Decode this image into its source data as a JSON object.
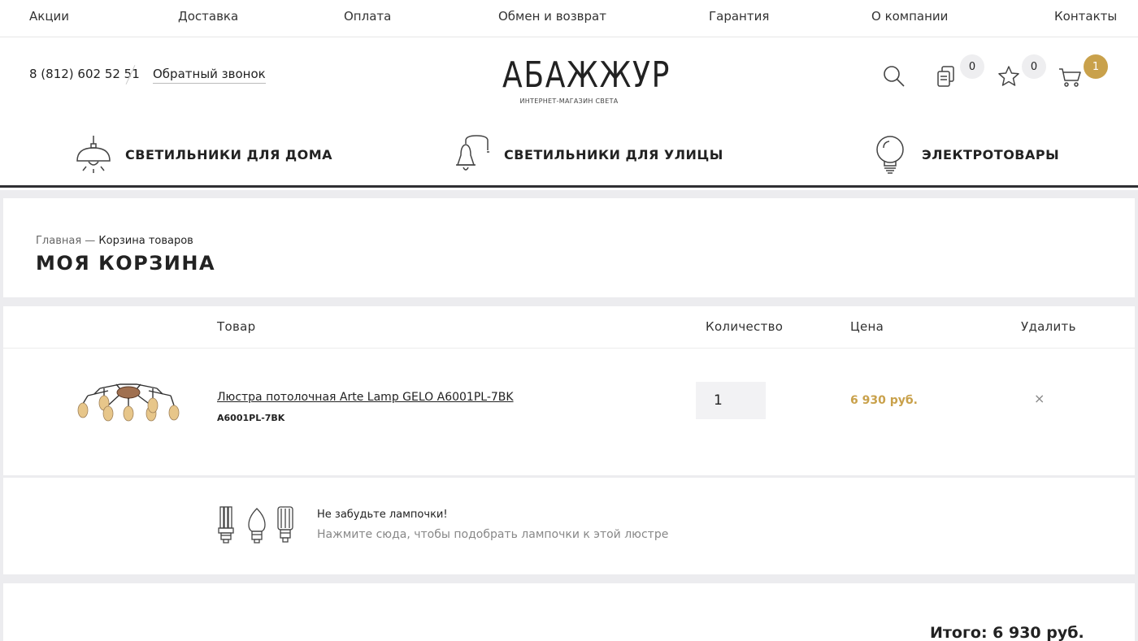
{
  "topnav": {
    "items": [
      "Акции",
      "Доставка",
      "Оплата",
      "Обмен и возврат",
      "Гарантия",
      "О компании",
      "Контакты"
    ]
  },
  "header": {
    "phone": "8 (812) 602 52 51",
    "callback": "Обратный звонок",
    "logo_main": "АБАЖЖУР",
    "logo_sub": "ИНТЕРНЕТ-МАГАЗИН СВЕТА",
    "compare_count": "0",
    "favorites_count": "0",
    "cart_count": "1",
    "icons": [
      "search-icon",
      "compare-icon",
      "star-icon",
      "cart-icon"
    ]
  },
  "categories": [
    {
      "label": "СВЕТИЛЬНИКИ ДЛЯ ДОМА",
      "icon": "pendant-lamp-icon"
    },
    {
      "label": "СВЕТИЛЬНИКИ ДЛЯ УЛИЦЫ",
      "icon": "street-lamp-icon"
    },
    {
      "label": "ЭЛЕКТРОТОВАРЫ",
      "icon": "bulb-icon"
    }
  ],
  "breadcrumb": {
    "home": "Главная",
    "separator": " — ",
    "current": "Корзина товаров"
  },
  "page_title": "МОЯ КОРЗИНА",
  "cart": {
    "columns": {
      "product": "Товар",
      "quantity": "Количество",
      "price": "Цена",
      "remove": "Удалить"
    },
    "items": [
      {
        "name": "Люстра потолочная Arte Lamp GELO A6001PL-7BK",
        "sku": "A6001PL-7BK",
        "quantity": "1",
        "price": "6 930 руб."
      }
    ],
    "remove_symbol": "×"
  },
  "bulb_reminder": {
    "title": "Не забудьте лампочки!",
    "text": "Нажмите сюда, чтобы подобрать лампочки к этой люстре"
  },
  "total": "Итого: 6 930 руб.",
  "colors": {
    "accent": "#c9a14b",
    "dark": "#2f2f33",
    "background": "#ececef"
  }
}
